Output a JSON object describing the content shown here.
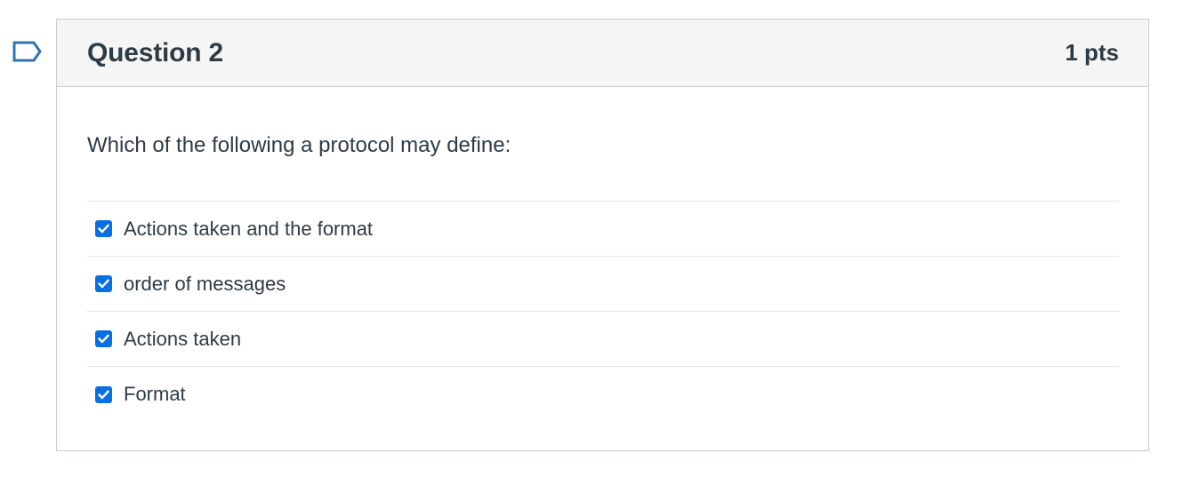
{
  "question": {
    "title": "Question 2",
    "points": "1 pts",
    "text": "Which of the following a protocol may define:",
    "flag_icon": "flag-outline-icon",
    "answers": [
      {
        "label": "Actions taken and the format",
        "checked": true
      },
      {
        "label": "order of messages",
        "checked": true
      },
      {
        "label": "Actions taken",
        "checked": true
      },
      {
        "label": "Format",
        "checked": true
      }
    ]
  },
  "colors": {
    "checkbox": "#0770e3",
    "header_bg": "#f5f5f5",
    "border": "#c7cdd1",
    "text": "#2d3b45"
  }
}
